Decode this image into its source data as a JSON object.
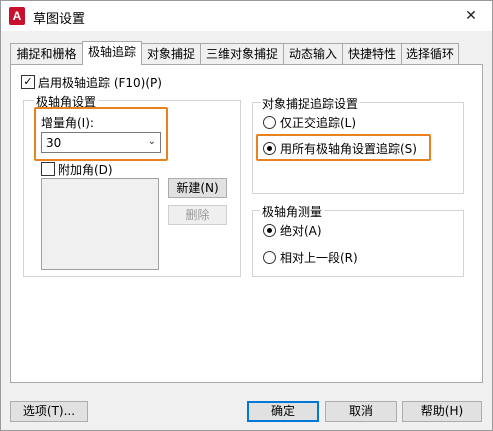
{
  "window": {
    "app_icon_letter": "A",
    "title": "草图设置",
    "close_glyph": "✕"
  },
  "tabs": [
    {
      "label": "捕捉和栅格"
    },
    {
      "label": "极轴追踪"
    },
    {
      "label": "对象捕捉"
    },
    {
      "label": "三维对象捕捉"
    },
    {
      "label": "动态输入"
    },
    {
      "label": "快捷特性"
    },
    {
      "label": "选择循环"
    }
  ],
  "active_tab": "极轴追踪",
  "enable_polar": {
    "label": "启用极轴追踪 (F10)(P)",
    "checked": true
  },
  "polar_angle": {
    "group_title": "极轴角设置",
    "increment_label": "增量角(I):",
    "increment_value": "30",
    "additional_label": "附加角(D)",
    "additional_checked": false,
    "new_button": "新建(N)",
    "delete_button": "删除"
  },
  "osnap_tracking": {
    "group_title": "对象捕捉追踪设置",
    "option_ortho": "仅正交追踪(L)",
    "option_all": "用所有极轴角设置追踪(S)",
    "selected": "option_all"
  },
  "polar_measure": {
    "group_title": "极轴角测量",
    "option_absolute": "绝对(A)",
    "option_relative": "相对上一段(R)",
    "selected": "option_absolute"
  },
  "footer": {
    "options_button": "选项(T)...",
    "ok_button": "确定",
    "cancel_button": "取消",
    "help_button": "帮助(H)"
  },
  "colors": {
    "highlight": "#e8821e",
    "app_icon": "#c8102e",
    "default_button_border": "#0078d7"
  },
  "icons": {
    "checkbox_checked": "checkmark-icon",
    "dropdown": "chevron-down-icon",
    "close": "close-icon"
  }
}
